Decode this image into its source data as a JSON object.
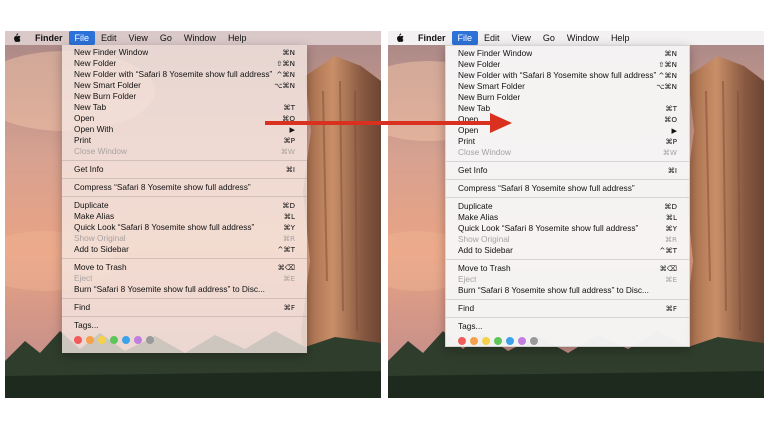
{
  "menubar": {
    "app_name": "Finder",
    "items": [
      "File",
      "Edit",
      "View",
      "Go",
      "Window",
      "Help"
    ],
    "active": "File"
  },
  "menu_before": [
    {
      "label": "New Finder Window",
      "shortcut": "⌘N"
    },
    {
      "label": "New Folder",
      "shortcut": "⇧⌘N"
    },
    {
      "label": "New Folder with “Safari 8 Yosemite show full address”",
      "shortcut": "^⌘N"
    },
    {
      "label": "New Smart Folder",
      "shortcut": "⌥⌘N"
    },
    {
      "label": "New Burn Folder",
      "shortcut": ""
    },
    {
      "label": "New Tab",
      "shortcut": "⌘T"
    },
    {
      "label": "Open",
      "shortcut": "⌘O"
    },
    {
      "label": "Open With",
      "shortcut": "▶"
    },
    {
      "label": "Print",
      "shortcut": "⌘P"
    },
    {
      "label": "Close Window",
      "shortcut": "⌘W",
      "disabled": true
    },
    {
      "separator": true
    },
    {
      "label": "Get Info",
      "shortcut": "⌘I"
    },
    {
      "separator": true
    },
    {
      "label": "Compress “Safari 8 Yosemite show full address”",
      "shortcut": ""
    },
    {
      "separator": true
    },
    {
      "label": "Duplicate",
      "shortcut": "⌘D"
    },
    {
      "label": "Make Alias",
      "shortcut": "⌘L"
    },
    {
      "label": "Quick Look “Safari 8 Yosemite show full address”",
      "shortcut": "⌘Y"
    },
    {
      "label": "Show Original",
      "shortcut": "⌘R",
      "disabled": true
    },
    {
      "label": "Add to Sidebar",
      "shortcut": "^⌘T"
    },
    {
      "separator": true
    },
    {
      "label": "Move to Trash",
      "shortcut": "⌘⌫"
    },
    {
      "label": "Eject",
      "shortcut": "⌘E",
      "disabled": true
    },
    {
      "label": "Burn “Safari 8 Yosemite show full address” to Disc...",
      "shortcut": ""
    },
    {
      "separator": true
    },
    {
      "label": "Find",
      "shortcut": "⌘F"
    },
    {
      "separator": true
    },
    {
      "label": "Tags...",
      "shortcut": ""
    }
  ],
  "menu_after": [
    {
      "label": "New Finder Window",
      "shortcut": "⌘N"
    },
    {
      "label": "New Folder",
      "shortcut": "⇧⌘N"
    },
    {
      "label": "New Folder with “Safari 8 Yosemite show full address”",
      "shortcut": "^⌘N"
    },
    {
      "label": "New Smart Folder",
      "shortcut": "⌥⌘N"
    },
    {
      "label": "New Burn Folder",
      "shortcut": ""
    },
    {
      "label": "New Tab",
      "shortcut": "⌘T"
    },
    {
      "label": "Open",
      "shortcut": "⌘O"
    },
    {
      "label": "Open",
      "shortcut": "▶"
    },
    {
      "label": "Print",
      "shortcut": "⌘P"
    },
    {
      "label": "Close Window",
      "shortcut": "⌘W",
      "disabled": true
    },
    {
      "separator": true
    },
    {
      "label": "Get Info",
      "shortcut": "⌘I"
    },
    {
      "separator": true
    },
    {
      "label": "Compress “Safari 8 Yosemite show full address”",
      "shortcut": ""
    },
    {
      "separator": true
    },
    {
      "label": "Duplicate",
      "shortcut": "⌘D"
    },
    {
      "label": "Make Alias",
      "shortcut": "⌘L"
    },
    {
      "label": "Quick Look “Safari 8 Yosemite show full address”",
      "shortcut": "⌘Y"
    },
    {
      "label": "Show Original",
      "shortcut": "⌘R",
      "disabled": true
    },
    {
      "label": "Add to Sidebar",
      "shortcut": "^⌘T"
    },
    {
      "separator": true
    },
    {
      "label": "Move to Trash",
      "shortcut": "⌘⌫"
    },
    {
      "label": "Eject",
      "shortcut": "⌘E",
      "disabled": true
    },
    {
      "label": "Burn “Safari 8 Yosemite show full address” to Disc...",
      "shortcut": ""
    },
    {
      "separator": true
    },
    {
      "label": "Find",
      "shortcut": "⌘F"
    },
    {
      "separator": true
    },
    {
      "label": "Tags...",
      "shortcut": ""
    }
  ],
  "tag_colors": [
    "#f05b5b",
    "#f5a04a",
    "#f3d24a",
    "#5dc65b",
    "#3da3e8",
    "#c07fe0",
    "#9a9a9a"
  ],
  "arrow_color": "#d9301f",
  "icons": {
    "apple": "apple-logo-icon",
    "arrow": "right-arrow-icon"
  }
}
